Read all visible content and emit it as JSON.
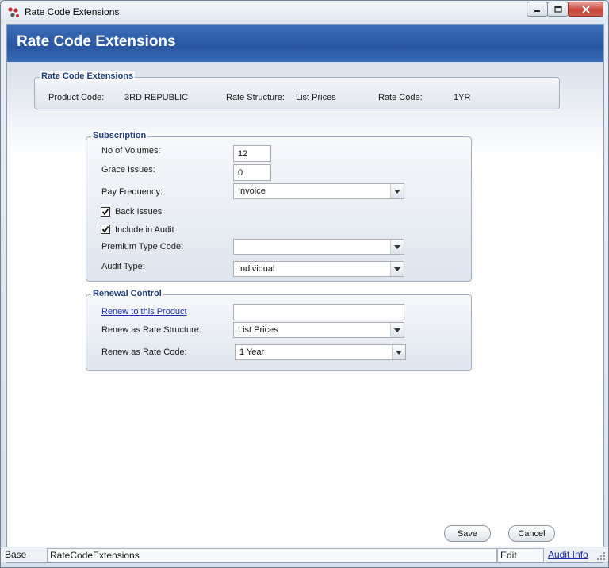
{
  "window": {
    "title": "Rate Code Extensions"
  },
  "header": {
    "title": "Rate Code Extensions"
  },
  "info_group": {
    "legend": "Rate Code Extensions",
    "product_code_label": "Product Code:",
    "product_code_value": "3RD REPUBLIC",
    "rate_structure_label": "Rate Structure:",
    "rate_structure_value": "List Prices",
    "rate_code_label": "Rate Code:",
    "rate_code_value": "1YR"
  },
  "subscription": {
    "legend": "Subscription",
    "volumes_label": "No of Volumes:",
    "volumes_value": "12",
    "grace_label": "Grace Issues:",
    "grace_value": "0",
    "pay_freq_label": "Pay Frequency:",
    "pay_freq_value": "Invoice",
    "back_issues_label": "Back Issues",
    "back_issues_checked": true,
    "include_audit_label": "Include in Audit",
    "include_audit_checked": true,
    "premium_label": "Premium Type Code:",
    "premium_value": "",
    "audit_type_label": "Audit Type:",
    "audit_type_value": "Individual"
  },
  "renewal": {
    "legend": "Renewal Control",
    "renew_product_link": "Renew to this Product",
    "renew_product_value": "",
    "renew_structure_label": "Renew as Rate Structure:",
    "renew_structure_value": "List Prices",
    "renew_code_label": "Renew as Rate Code:",
    "renew_code_value": "1 Year"
  },
  "buttons": {
    "save": "Save",
    "cancel": "Cancel"
  },
  "statusbar": {
    "base": "Base",
    "form": "RateCodeExtensions",
    "mode": "Edit",
    "audit_link": "Audit Info"
  },
  "icons": {
    "minimize": "minimize-icon",
    "maximize": "maximize-icon",
    "close": "close-icon",
    "dropdown": "chevron-down-icon",
    "check": "checkmark-icon",
    "grip": "resize-grip-icon"
  },
  "colors": {
    "header_band": "#2a56a1",
    "legend_text": "#1f3f78",
    "link": "#1c2fa8"
  }
}
